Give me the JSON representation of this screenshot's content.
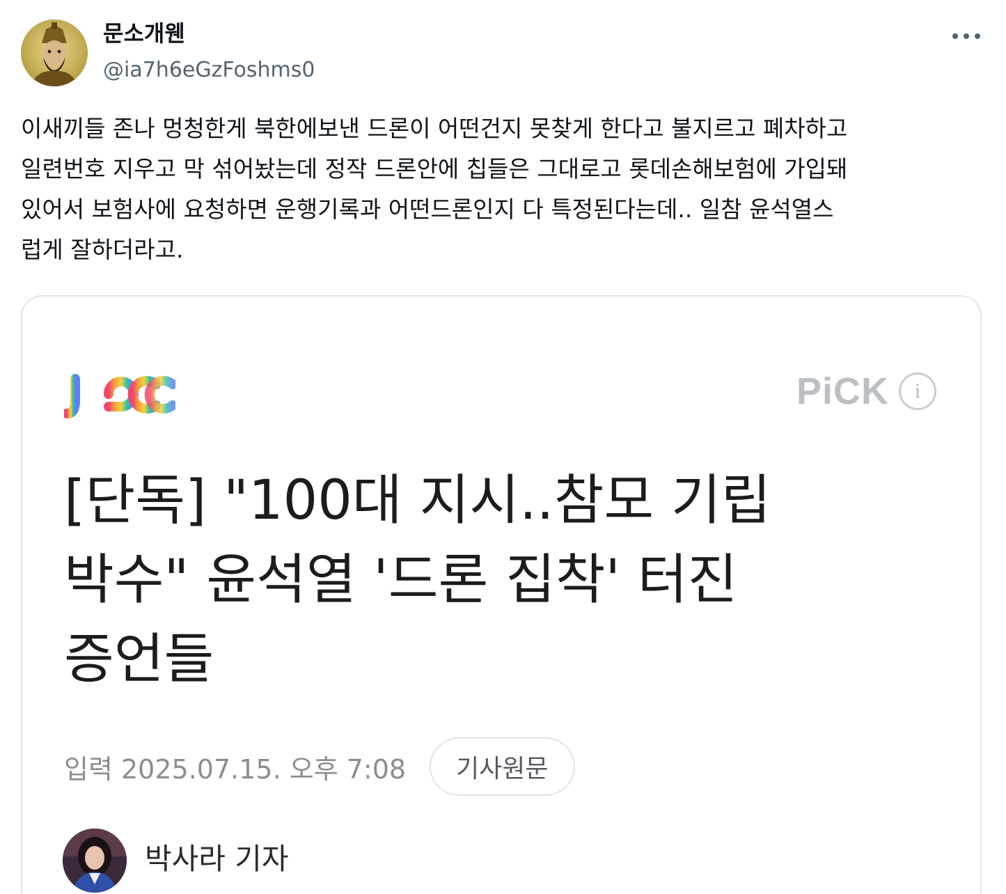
{
  "tweet": {
    "display_name": "문소개웬",
    "handle": "@ia7h6eGzFoshms0",
    "more_icon": "more-horizontal-icon",
    "text_lines": [
      "이새끼들 존나 멍청한게 북한에보낸 드론이 어떤건지 못찾게 한다고 불지르고 폐차하고",
      "일련번호 지우고 막 섞어놨는데 정작 드론안에 칩들은 그대로고 롯데손해보험에 가입돼",
      "있어서 보험사에 요청하면 운행기록과 어떤드론인지 다 특정된다는데.. 일참 윤석열스",
      "럽게 잘하더라고."
    ]
  },
  "card": {
    "logo": "jtbc-logo",
    "pick_label": "PiCK",
    "info_icon_glyph": "i",
    "headline_lines": [
      "[단독] \"100대 지시..참모 기립",
      "박수\" 윤석열 '드론 집착' 터진",
      "증언들"
    ],
    "input_date": "입력 2025.07.15. 오후 7:08",
    "original_button_label": "기사원문",
    "reporter_name": "박사라 기자"
  },
  "colors": {
    "text_primary": "#0f1419",
    "text_secondary": "#536471",
    "card_border": "#e3e5e8",
    "pick_gray": "#bcbfc4",
    "date_gray": "#8a8d91"
  }
}
